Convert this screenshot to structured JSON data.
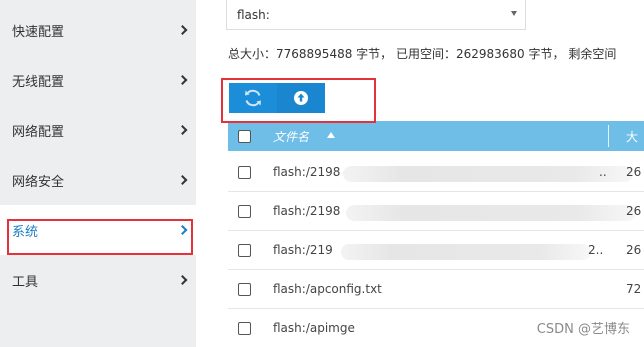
{
  "sidebar": {
    "items": [
      {
        "label": "快速配置"
      },
      {
        "label": "无线配置"
      },
      {
        "label": "网络配置"
      },
      {
        "label": "网络安全"
      },
      {
        "label": "系统"
      },
      {
        "label": "工具"
      }
    ],
    "active_index": 4
  },
  "file_system": {
    "selected": "flash:",
    "info": "总大小：7768895488 字节， 已用空间：262983680 字节， 剩余空间"
  },
  "toolbar": {
    "refresh_icon": "refresh-icon",
    "upload_icon": "upload-icon"
  },
  "table": {
    "header_name": "文件名",
    "header_size": "大",
    "rows": [
      {
        "name": "flash:/2198",
        "suffix": "..",
        "size": "26"
      },
      {
        "name": "flash:/2198",
        "suffix": "",
        "size": "26"
      },
      {
        "name": "flash:/219",
        "suffix": "2..",
        "size": "26"
      },
      {
        "name": "flash:/apconfig.txt",
        "suffix": "",
        "size": "72"
      },
      {
        "name": "flash:/apimge",
        "suffix": "",
        "size": ""
      }
    ]
  },
  "watermark": "CSDN @艺博东",
  "colors": {
    "accent": "#1c8ed9",
    "header": "#6fbee8",
    "active_text": "#1a7ec6",
    "highlight_box": "#e5323a"
  }
}
